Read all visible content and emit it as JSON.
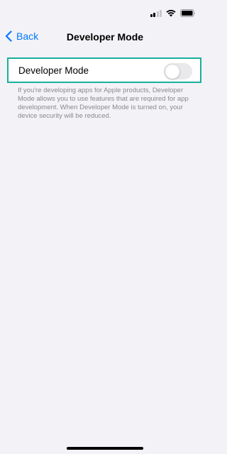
{
  "status_bar": {
    "signal_icon": "cellular-signal-icon",
    "wifi_icon": "wifi-icon",
    "battery_icon": "battery-icon"
  },
  "nav": {
    "back_label": "Back",
    "back_icon": "chevron-left-icon",
    "title": "Developer Mode"
  },
  "setting": {
    "label": "Developer Mode",
    "toggle_on": false
  },
  "footer": {
    "text": "If you're developing apps for Apple products, Developer Mode allows you to use features that are required for app development. When Developer Mode is turned on, your device security will be reduced."
  },
  "colors": {
    "accent": "#007aff",
    "highlight_border": "#1aaf9c",
    "background": "#f2f2f7",
    "toggle_off": "#e9e9eb"
  }
}
